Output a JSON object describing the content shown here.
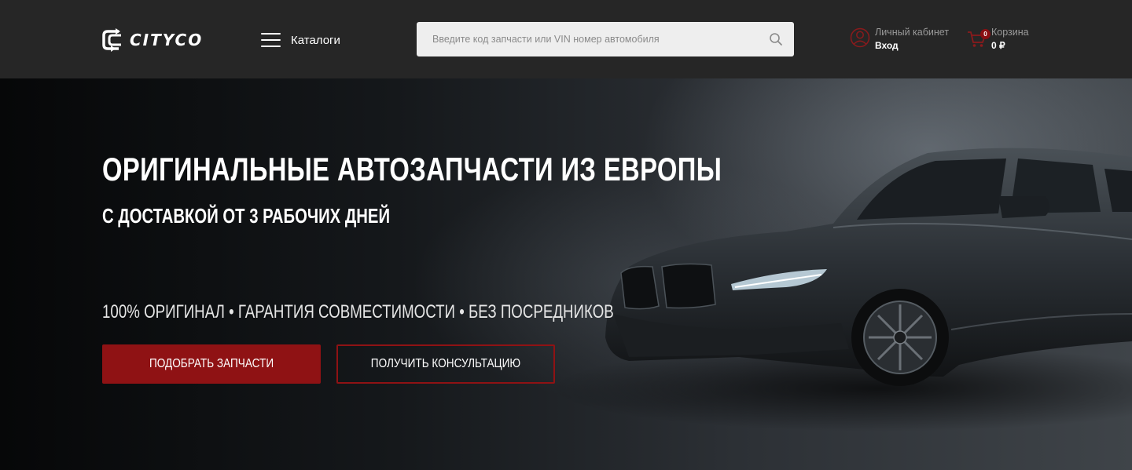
{
  "header": {
    "logo_text": "CITYCO",
    "catalog_label": "Каталоги",
    "search": {
      "placeholder": "Введите код запчасти или VIN номер автомобиля",
      "value": ""
    },
    "account": {
      "label": "Личный кабинет",
      "action": "Вход"
    },
    "cart": {
      "label": "Корзина",
      "total": "0 ₽",
      "count": "0"
    }
  },
  "hero": {
    "title": "ОРИГИНАЛЬНЫЕ АВТОЗАПЧАСТИ ИЗ ЕВРОПЫ",
    "subtitle": "С ДОСТАВКОЙ ОТ 3 РАБОЧИХ ДНЕЙ",
    "features": "100% ОРИГИНАЛ • ГАРАНТИЯ СОВМЕСТИМОСТИ • БЕЗ ПОСРЕДНИКОВ",
    "primary_button": "ПОДОБРАТЬ ЗАПЧАСТИ",
    "secondary_button": "ПОЛУЧИТЬ КОНСУЛЬТАЦИЮ"
  },
  "colors": {
    "header_bg": "#262626",
    "accent": "#8f1214",
    "icon_accent": "#8b1a1c",
    "hero_bg": "#0c0d0f"
  },
  "icons": {
    "logo": "cityco-logo-icon",
    "menu": "burger-menu-icon",
    "search": "search-icon",
    "account": "user-icon",
    "cart": "cart-icon"
  }
}
